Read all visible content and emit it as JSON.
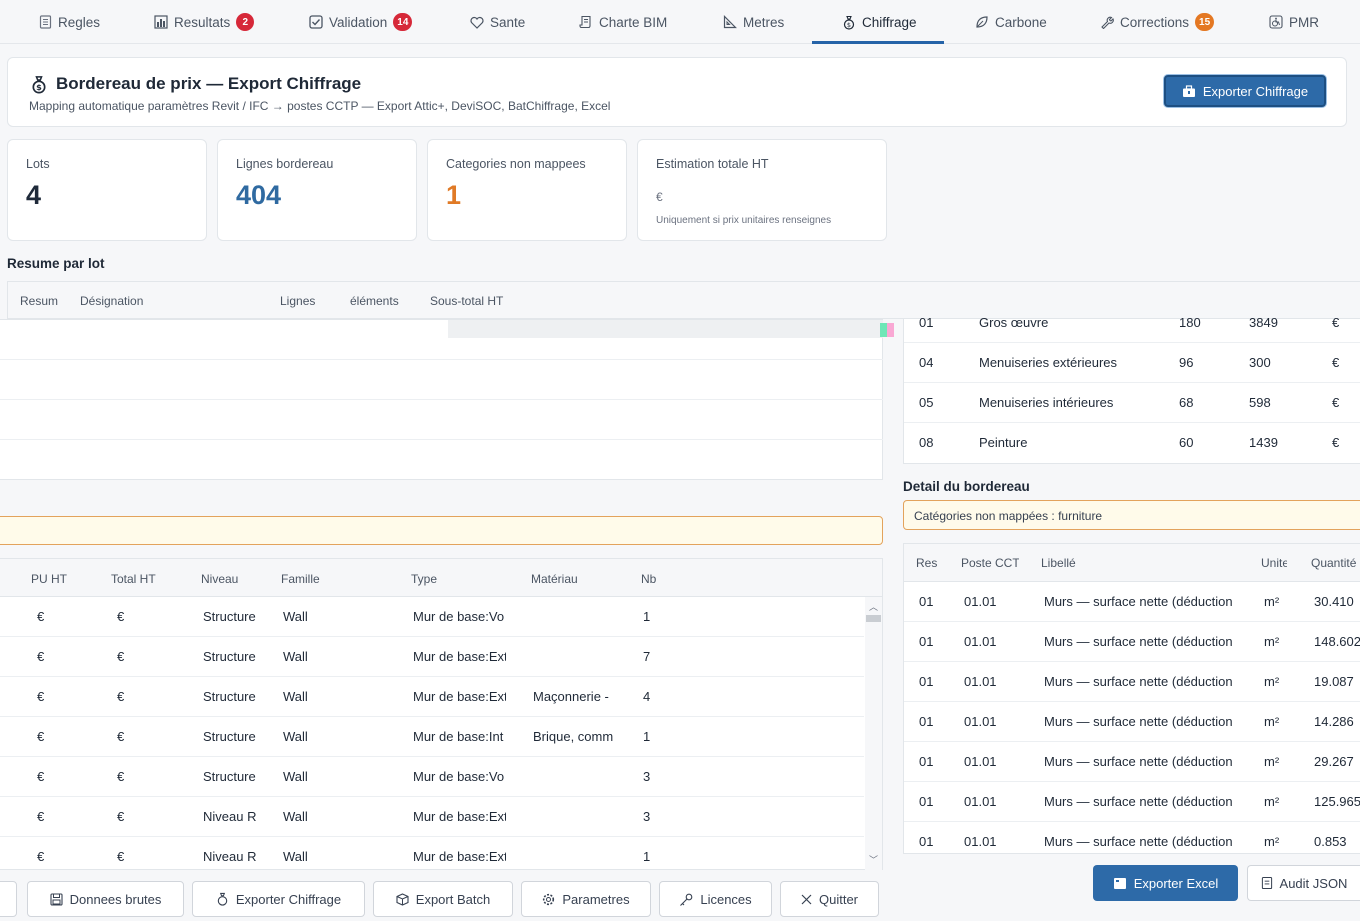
{
  "tabs": [
    {
      "label": "Regles",
      "icon": "document-icon"
    },
    {
      "label": "Resultats",
      "icon": "bar-chart-icon",
      "badge": "2",
      "badge_color": "#d62839"
    },
    {
      "label": "Validation",
      "icon": "checkbox-icon",
      "badge": "14",
      "badge_color": "#d62839"
    },
    {
      "label": "Sante",
      "icon": "heart-icon"
    },
    {
      "label": "Charte BIM",
      "icon": "scroll-icon"
    },
    {
      "label": "Metres",
      "icon": "ruler-icon"
    },
    {
      "label": "Chiffrage",
      "icon": "money-bag-icon",
      "active": true
    },
    {
      "label": "Carbone",
      "icon": "leaf-icon"
    },
    {
      "label": "Corrections",
      "icon": "wrench-icon",
      "badge": "15",
      "badge_color": "#e47823"
    },
    {
      "label": "PMR",
      "icon": "wheelchair-icon"
    }
  ],
  "header": {
    "title": "Bordereau de prix — Export Chiffrage",
    "subtitle": "Mapping automatique paramètres Revit / IFC → postes CCTP — Export Attic+, DeviSOC, BatChiffrage, Excel",
    "export_button": "Exporter Chiffrage"
  },
  "stats": {
    "lots": {
      "label": "Lots",
      "value": "4"
    },
    "lignes": {
      "label": "Lignes bordereau",
      "value": "404"
    },
    "non_mappees": {
      "label": "Categories non mappees",
      "value": "1"
    },
    "estimation": {
      "label": "Estimation totale HT",
      "value": "€",
      "hint": "Uniquement si prix unitaires renseignes"
    }
  },
  "resume": {
    "title": "Resume par lot",
    "columns": [
      "Resum",
      "Désignation",
      "Lignes",
      "éléments",
      "Sous-total HT"
    ],
    "rows": [
      {
        "lot": "01",
        "designation": "Gros œuvre",
        "lignes": "180",
        "elements": "3849",
        "sous_total": "€"
      },
      {
        "lot": "04",
        "designation": "Menuiseries extérieures",
        "lignes": "96",
        "elements": "300",
        "sous_total": "€"
      },
      {
        "lot": "05",
        "designation": "Menuiseries intérieures",
        "lignes": "68",
        "elements": "598",
        "sous_total": "€"
      },
      {
        "lot": "08",
        "designation": "Peinture",
        "lignes": "60",
        "elements": "1439",
        "sous_total": "€"
      }
    ]
  },
  "detail": {
    "title": "Detail du bordereau",
    "warning": "Catégories non mappées : furniture",
    "right_columns": [
      "Resum",
      "Poste CCTP",
      "Libellé",
      "Unite",
      "Quantité"
    ],
    "left_columns": [
      "PU HT",
      "Total HT",
      "Niveau",
      "Famille",
      "Type",
      "Matériau",
      "Nb"
    ],
    "right_rows": [
      {
        "lot": "01",
        "poste": "01.01",
        "libelle": "Murs — surface nette (déduction",
        "unite": "m²",
        "quantite": "30.410"
      },
      {
        "lot": "01",
        "poste": "01.01",
        "libelle": "Murs — surface nette (déduction",
        "unite": "m²",
        "quantite": "148.602"
      },
      {
        "lot": "01",
        "poste": "01.01",
        "libelle": "Murs — surface nette (déduction",
        "unite": "m²",
        "quantite": "19.087"
      },
      {
        "lot": "01",
        "poste": "01.01",
        "libelle": "Murs — surface nette (déduction",
        "unite": "m²",
        "quantite": "14.286"
      },
      {
        "lot": "01",
        "poste": "01.01",
        "libelle": "Murs — surface nette (déduction",
        "unite": "m²",
        "quantite": "29.267"
      },
      {
        "lot": "01",
        "poste": "01.01",
        "libelle": "Murs — surface nette (déduction",
        "unite": "m²",
        "quantite": "125.965"
      },
      {
        "lot": "01",
        "poste": "01.01",
        "libelle": "Murs — surface nette (déduction",
        "unite": "m²",
        "quantite": "0.853"
      }
    ],
    "left_rows": [
      {
        "pu": "€",
        "total": "€",
        "niveau": "Structure",
        "famille": "Wall",
        "type": "Mur de base:Vo",
        "materiau": "",
        "nb": "1"
      },
      {
        "pu": "€",
        "total": "€",
        "niveau": "Structure",
        "famille": "Wall",
        "type": "Mur de base:Ext",
        "materiau": "",
        "nb": "7"
      },
      {
        "pu": "€",
        "total": "€",
        "niveau": "Structure",
        "famille": "Wall",
        "type": "Mur de base:Ext",
        "materiau": "Maçonnerie -",
        "nb": "4"
      },
      {
        "pu": "€",
        "total": "€",
        "niveau": "Structure",
        "famille": "Wall",
        "type": "Mur de base:Int",
        "materiau": "Brique, comm",
        "nb": "1"
      },
      {
        "pu": "€",
        "total": "€",
        "niveau": "Structure",
        "famille": "Wall",
        "type": "Mur de base:Vo",
        "materiau": "",
        "nb": "3"
      },
      {
        "pu": "€",
        "total": "€",
        "niveau": "Niveau R",
        "famille": "Wall",
        "type": "Mur de base:Ext",
        "materiau": "",
        "nb": "3"
      },
      {
        "pu": "€",
        "total": "€",
        "niveau": "Niveau R",
        "famille": "Wall",
        "type": "Mur de base:Ext",
        "materiau": "",
        "nb": "1"
      }
    ]
  },
  "footer_buttons": {
    "donnees": "Donnees brutes",
    "exporter": "Exporter Chiffrage",
    "batch": "Export Batch",
    "parametres": "Parametres",
    "licences": "Licences",
    "quitter": "Quitter",
    "excel": "Exporter Excel",
    "audit": "Audit JSON"
  },
  "colors": {
    "accent": "#2d6aa8",
    "value_blue": "#2f6aa1",
    "value_orange": "#e07a26",
    "dark": "#1f2a3a"
  }
}
